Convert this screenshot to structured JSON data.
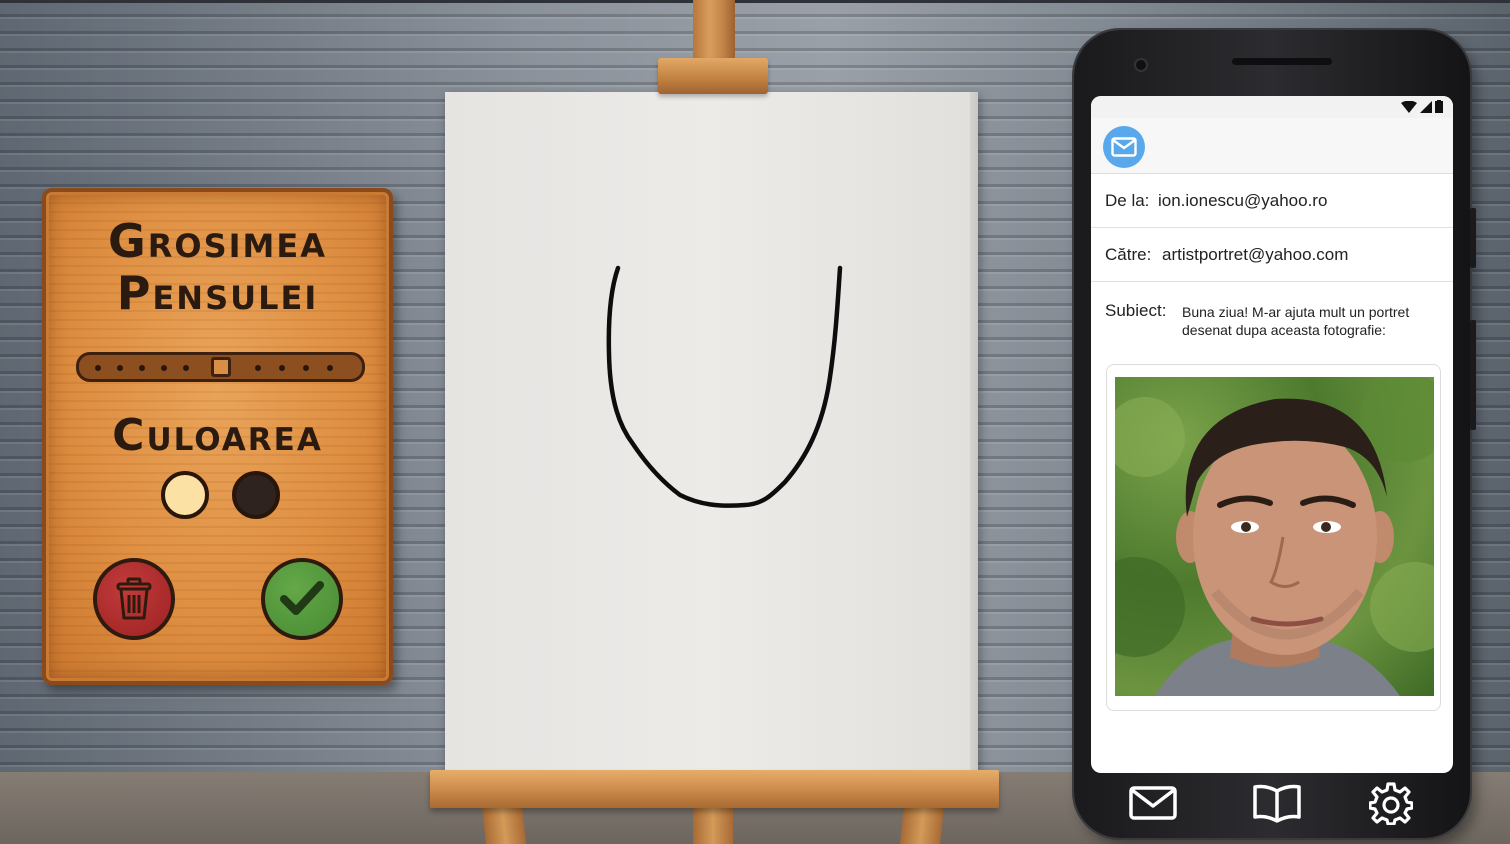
{
  "panel": {
    "brush_title_line1": "Grosimea",
    "brush_title_line2": "Pensulei",
    "color_title": "Culoarea",
    "brush_size_fraction": 0.5,
    "colors": [
      "#fbe2a4",
      "#2e231e"
    ],
    "delete_icon": "trash-icon",
    "confirm_icon": "checkmark-icon"
  },
  "email": {
    "from_label": "De la:",
    "from_value": "ion.ionescu@yahoo.ro",
    "to_label": "Către:",
    "to_value": "artistportret@yahoo.com",
    "subject_label": "Subiect:",
    "subject_text": "Buna ziua! M-ar ajuta mult un portret desenat dupa aceasta fotografie:",
    "app_icon": "envelope-icon",
    "attachment_icon": "portrait-photo"
  },
  "phone_nav": {
    "items": [
      "mail-icon",
      "book-icon",
      "gear-icon"
    ]
  },
  "colors": {
    "panel_wood": "#df8f42",
    "delete_red": "#9c2222",
    "confirm_green": "#478a33",
    "mail_badge": "#5aa8ec"
  }
}
